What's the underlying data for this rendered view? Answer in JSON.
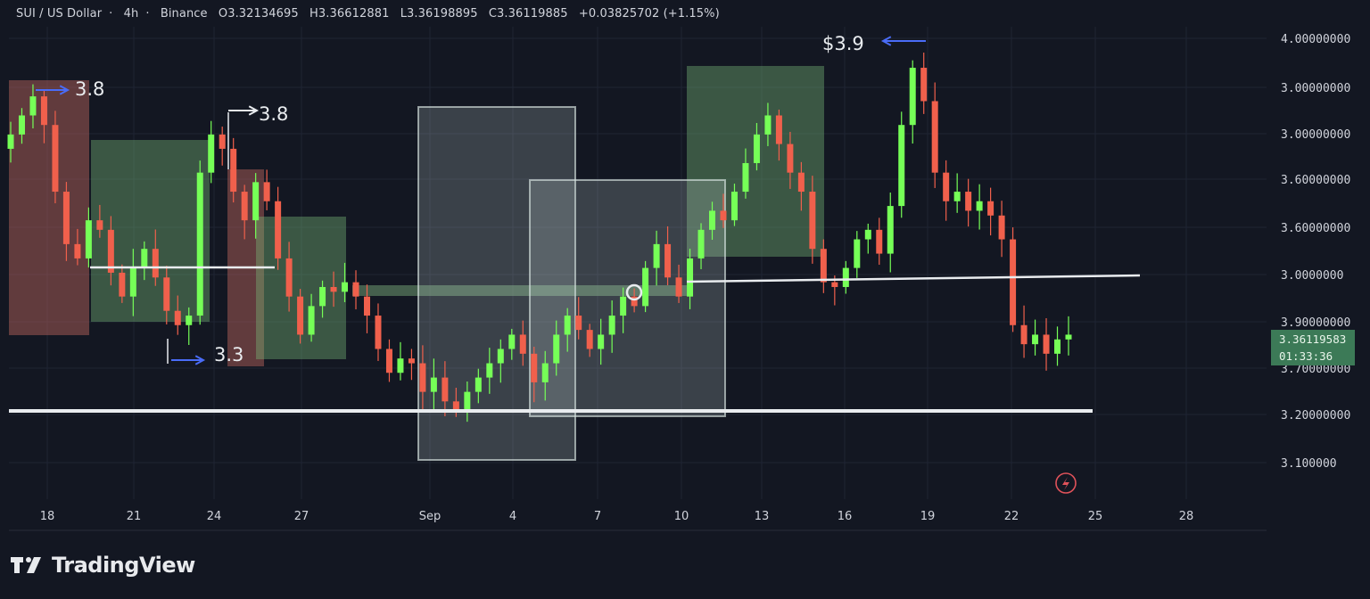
{
  "header": {
    "symbol": "SUI / US Dollar",
    "interval": "4h",
    "exchange": "Binance",
    "open": "O3.32134695",
    "high": "H3.36612881",
    "low": "L3.36198895",
    "close": "C3.36119885",
    "change": "+0.03825702 (+1.15%)"
  },
  "price_tag": {
    "price": "3.36119583",
    "countdown": "01:33:36"
  },
  "brand": {
    "name": "TradingView"
  },
  "annotations": [
    "3.8",
    "3.8",
    "3.3",
    "$3.9"
  ],
  "colors": {
    "background": "#131722",
    "up": "#76ff57",
    "down": "#f0604c",
    "grid": "#1f2433",
    "accent_arrow": "#4a6cf7"
  },
  "chart_data": {
    "type": "candlestick",
    "timeframe": "4h",
    "x_ticks": [
      "18",
      "21",
      "24",
      "27",
      "Sep",
      "4",
      "7",
      "10",
      "13",
      "16",
      "19",
      "22",
      "25",
      "28"
    ],
    "y_ticks": [
      "4.00000000",
      "3.00000000",
      "3.00000000",
      "3.60000000",
      "3.60000000",
      "3.0000000",
      "3.90000000",
      "3.70000000",
      "3.20000000",
      "3.100000"
    ],
    "approx_closes": [
      3.78,
      3.82,
      3.86,
      3.8,
      3.66,
      3.55,
      3.52,
      3.6,
      3.58,
      3.49,
      3.44,
      3.5,
      3.54,
      3.48,
      3.41,
      3.38,
      3.4,
      3.7,
      3.78,
      3.75,
      3.66,
      3.6,
      3.68,
      3.64,
      3.52,
      3.44,
      3.36,
      3.42,
      3.46,
      3.45,
      3.47,
      3.44,
      3.4,
      3.33,
      3.28,
      3.31,
      3.3,
      3.24,
      3.27,
      3.22,
      3.2,
      3.24,
      3.27,
      3.3,
      3.33,
      3.36,
      3.32,
      3.26,
      3.3,
      3.36,
      3.4,
      3.37,
      3.33,
      3.36,
      3.4,
      3.44,
      3.42,
      3.5,
      3.55,
      3.48,
      3.44,
      3.52,
      3.58,
      3.62,
      3.6,
      3.66,
      3.72,
      3.78,
      3.82,
      3.76,
      3.7,
      3.66,
      3.54,
      3.47,
      3.46,
      3.5,
      3.56,
      3.58,
      3.53,
      3.63,
      3.8,
      3.92,
      3.85,
      3.7,
      3.64,
      3.66,
      3.62,
      3.64,
      3.61,
      3.56,
      3.38,
      3.34,
      3.36,
      3.32,
      3.35,
      3.36
    ],
    "annotations": [
      {
        "label": "3.8"
      },
      {
        "label": "3.8"
      },
      {
        "label": "3.3"
      },
      {
        "label": "$3.9"
      }
    ],
    "drawn_zones": [
      "supply",
      "demand",
      "range"
    ],
    "grid": true
  }
}
